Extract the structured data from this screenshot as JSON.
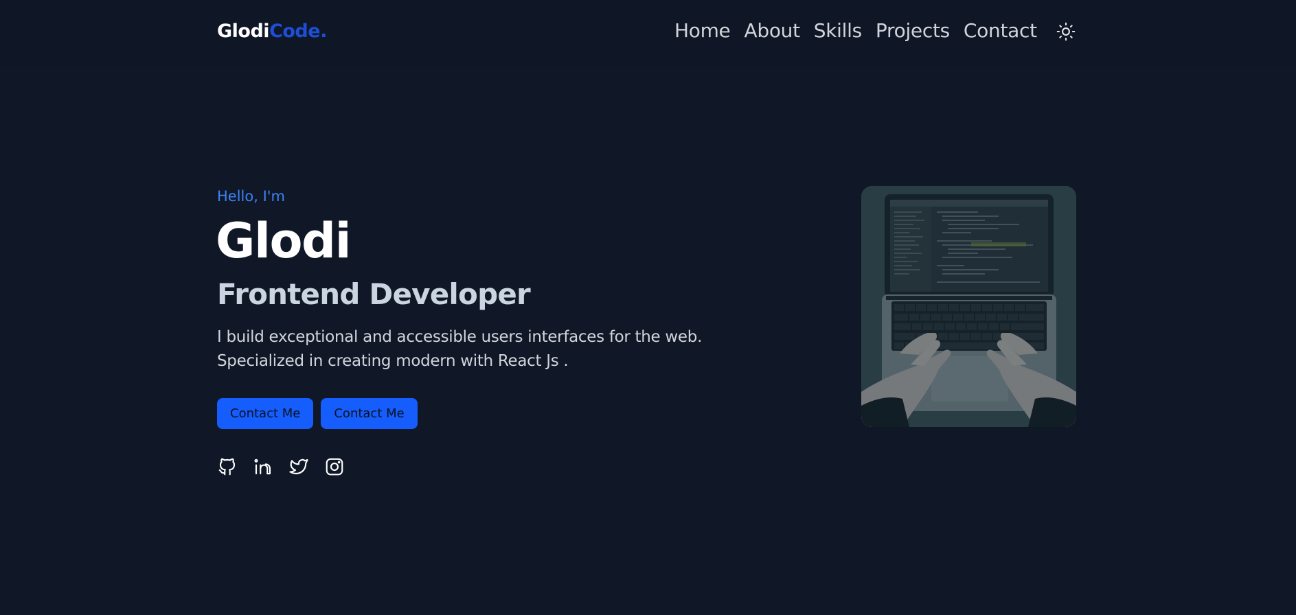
{
  "header": {
    "logo_main": "Glodi",
    "logo_accent": "Code.",
    "nav": [
      {
        "label": "Home"
      },
      {
        "label": "About"
      },
      {
        "label": "Skills"
      },
      {
        "label": "Projects"
      },
      {
        "label": "Contact"
      }
    ],
    "theme_icon": "sun-icon"
  },
  "hero": {
    "greeting": "Hello, I'm",
    "name": "Glodi",
    "role": "Frontend Developer",
    "description_line1": "I build exceptional and accessible users interfaces for the web.",
    "description_line2": "Specialized in creating modern with React Js .",
    "buttons": [
      {
        "label": "Contact Me"
      },
      {
        "label": "Contact Me"
      }
    ],
    "socials": [
      {
        "icon": "github-icon"
      },
      {
        "icon": "linkedin-icon"
      },
      {
        "icon": "twitter-icon"
      },
      {
        "icon": "instagram-icon"
      }
    ],
    "image_subject": "laptop-typing-photo"
  },
  "colors": {
    "background": "#101828",
    "header_background": "#0f1726",
    "accent": "#155dfc",
    "greeting": "#3b82f6",
    "logo_accent": "#1d4ed8",
    "text_primary": "#ffffff",
    "text_secondary": "#cbd5e1"
  }
}
